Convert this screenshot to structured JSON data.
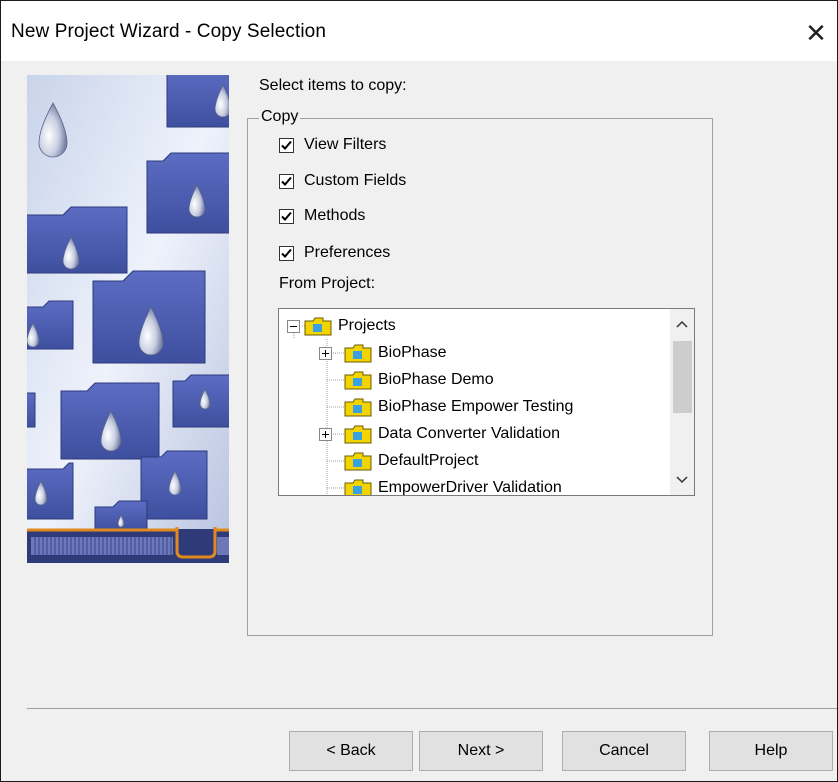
{
  "window": {
    "title": "New Project Wizard - Copy Selection",
    "close_glyph": "✕"
  },
  "prompt": "Select items to copy:",
  "copy_group": {
    "label": "Copy",
    "items": [
      {
        "label": "View Filters",
        "checked": true
      },
      {
        "label": "Custom Fields",
        "checked": true
      },
      {
        "label": "Methods",
        "checked": true
      },
      {
        "label": "Preferences",
        "checked": true
      }
    ]
  },
  "from_project": {
    "label": "From Project:",
    "tree": {
      "root": "Projects",
      "items": [
        {
          "label": "BioPhase",
          "expandable": true
        },
        {
          "label": "BioPhase Demo",
          "expandable": false
        },
        {
          "label": "BioPhase Empower Testing",
          "expandable": false
        },
        {
          "label": "Data Converter Validation",
          "expandable": true
        },
        {
          "label": "DefaultProject",
          "expandable": false
        },
        {
          "label": "EmpowerDriver Validation",
          "expandable": false
        }
      ]
    }
  },
  "buttons": {
    "back": "< Back",
    "next": "Next >",
    "cancel": "Cancel",
    "help": "Help"
  },
  "colors": {
    "folder": "#f2d400",
    "art_blue": "#4a5bb0",
    "accent_orange": "#e08a1e"
  }
}
